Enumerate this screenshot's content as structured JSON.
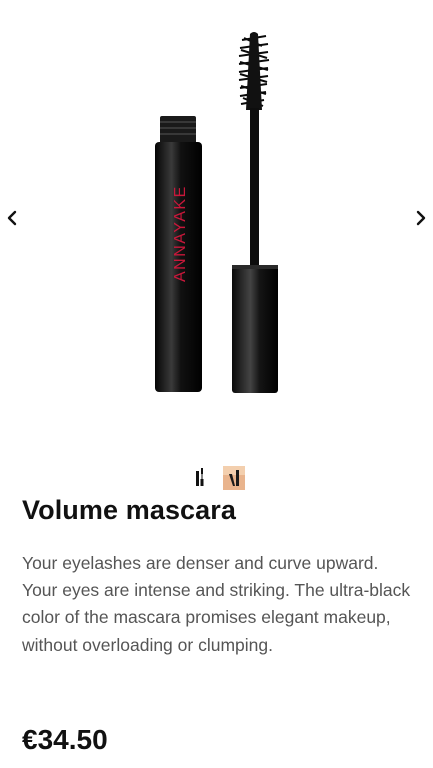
{
  "product": {
    "brand_on_tube": "ANNAYAKE",
    "name": "Volume mascara",
    "description": "Your eyelashes are denser and curve upward. Your eyes are intense and striking. The ultra-black color of the mascara promises elegant makeup, without overloading or clumping.",
    "price": "€34.50"
  },
  "gallery": {
    "prev_icon": "chevron-left-icon",
    "next_icon": "chevron-right-icon",
    "thumbnails": [
      "mascara-product-thumb",
      "mascara-lifestyle-thumb"
    ]
  },
  "colors": {
    "brand_red": "#c8173a",
    "tube_black": "#0d0d0d",
    "text_dark": "#111111",
    "text_body": "#555555"
  }
}
